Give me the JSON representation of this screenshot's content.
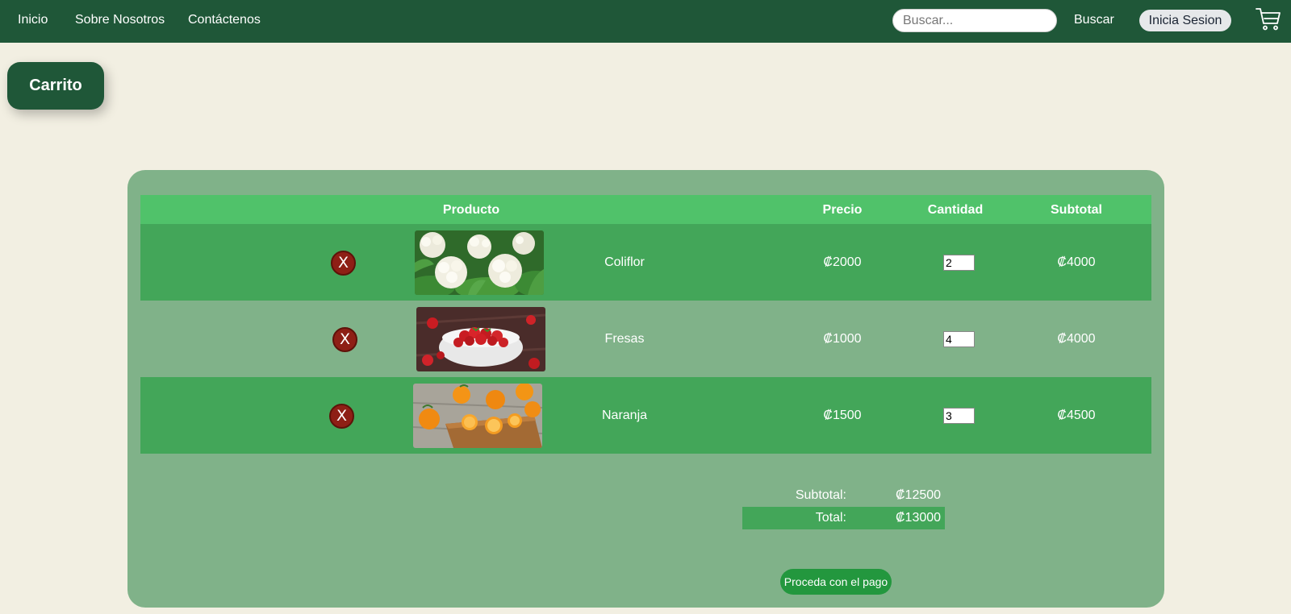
{
  "nav": {
    "links": [
      "Inicio",
      "Sobre Nosotros",
      "Contáctenos"
    ],
    "search_placeholder": "Buscar...",
    "search_label": "Buscar",
    "login_label": "Inicia Sesion",
    "cart_icon": "cart-icon"
  },
  "page": {
    "title": "Carrito"
  },
  "table": {
    "headers": {
      "producto": "Producto",
      "precio": "Precio",
      "cantidad": "Cantidad",
      "subtotal": "Subtotal"
    },
    "remove_label": "X",
    "rows": [
      {
        "name": "Coliflor",
        "price": "₡2000",
        "qty": "2",
        "subtotal": "₡4000",
        "image": "cauliflower-image"
      },
      {
        "name": "Fresas",
        "price": "₡1000",
        "qty": "4",
        "subtotal": "₡4000",
        "image": "strawberries-image"
      },
      {
        "name": "Naranja",
        "price": "₡1500",
        "qty": "3",
        "subtotal": "₡4500",
        "image": "oranges-image"
      }
    ]
  },
  "totals": {
    "subtotal_label": "Subtotal:",
    "subtotal_value": "₡12500",
    "total_label": "Total:",
    "total_value": "₡13000"
  },
  "pay_label": "Proceda con el pago",
  "colors": {
    "navbar": "#1f5738",
    "background": "#f2efe2",
    "panel": "#80b289",
    "header_row": "#50c26a",
    "row_highlight": "#43a659",
    "remove_button": "#8e1f15",
    "pay_button": "#23973e"
  }
}
